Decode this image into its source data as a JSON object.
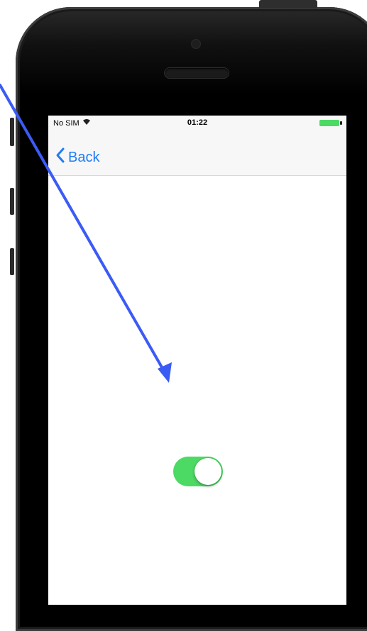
{
  "status_bar": {
    "carrier": "No SIM",
    "time": "01:22",
    "wifi_icon": "wifi-icon",
    "battery_icon": "battery-icon",
    "battery_color": "#4cd964"
  },
  "navigation": {
    "back_label": "Back",
    "back_icon": "chevron-left-icon",
    "accent_color": "#1f7cf5"
  },
  "toggle": {
    "state": "on",
    "on_color": "#4cd964"
  },
  "annotation": {
    "arrow_color": "#3b5bf5"
  }
}
